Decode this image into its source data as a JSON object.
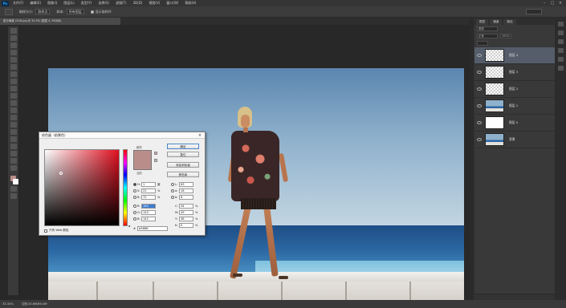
{
  "app": {
    "logo_text": "Ps"
  },
  "menu": [
    "文件(F)",
    "编辑(E)",
    "图像(I)",
    "图层(L)",
    "类型(Y)",
    "选择(S)",
    "滤镜(T)",
    "3D(D)",
    "视图(V)",
    "窗口(W)",
    "帮助(H)"
  ],
  "window_controls": {
    "minimize": "–",
    "maximize": "□",
    "close": "×"
  },
  "options_bar": {
    "sample_size_label": "取样大小:",
    "sample_size_value": "取样点",
    "sample_label": "样本:",
    "sample_value": "所有图层",
    "show_ring_label": "显示取样环"
  },
  "document": {
    "tab_title": "夏日海滩 2016.jpg @ 33.3% (图层 4, RGB/8)"
  },
  "color_picker": {
    "title": "拾色器（前景色）",
    "close": "×",
    "new_label": "新的",
    "current_label": "当前",
    "ok_label": "确定",
    "reset_label": "复位",
    "add_swatch_label": "添加到色板",
    "color_library_label": "颜色库",
    "web_only_label": "只有 Web 颜色",
    "hue_arrow": "◄",
    "fields": {
      "H": {
        "label": "H:",
        "value": "1",
        "unit": "度"
      },
      "S": {
        "label": "S:",
        "value": "22",
        "unit": "%"
      },
      "B": {
        "label": "B:",
        "value": "72",
        "unit": "%"
      },
      "R": {
        "label": "R:",
        "value": "185",
        "unit": ""
      },
      "G": {
        "label": "G:",
        "value": "143",
        "unit": ""
      },
      "Bl": {
        "label": "B:",
        "value": "142",
        "unit": ""
      },
      "L": {
        "label": "L:",
        "value": "63",
        "unit": ""
      },
      "a": {
        "label": "a:",
        "value": "18",
        "unit": ""
      },
      "b": {
        "label": "b:",
        "value": "6",
        "unit": ""
      },
      "C": {
        "label": "C:",
        "value": "34",
        "unit": "%"
      },
      "M": {
        "label": "M:",
        "value": "49",
        "unit": "%"
      },
      "Y": {
        "label": "Y:",
        "value": "38",
        "unit": "%"
      },
      "K": {
        "label": "K:",
        "value": "0",
        "unit": "%"
      }
    },
    "hex_label": "#",
    "hex_value": "b98f8f",
    "color": "#b98e8a"
  },
  "layers_panel": {
    "tabs": [
      "图层",
      "通道",
      "路径"
    ],
    "kind_filter": "类型",
    "blend_mode": "正常",
    "opacity": "100%",
    "layers": [
      {
        "name": "图层 4",
        "thumb": "checker",
        "active": true
      },
      {
        "name": "图层 3",
        "thumb": "checker",
        "active": false
      },
      {
        "name": "图层 2",
        "thumb": "checker",
        "active": false
      },
      {
        "name": "图层 1",
        "thumb": "scene",
        "active": false
      },
      {
        "name": "图层 0",
        "thumb": "white",
        "active": false
      },
      {
        "name": "背景",
        "thumb": "scene",
        "active": false
      }
    ]
  },
  "status": {
    "zoom": "33.33%",
    "doc_info": "文档:20.6M/85.4M"
  }
}
